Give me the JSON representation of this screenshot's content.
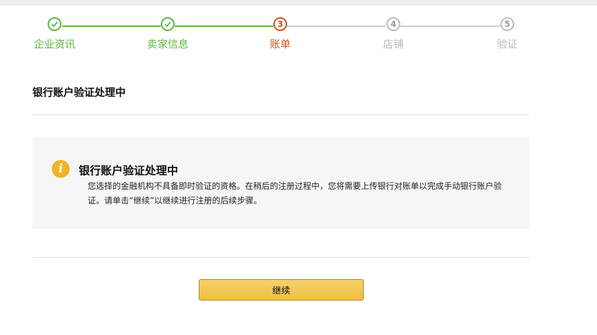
{
  "stepper": {
    "steps": [
      {
        "number": "1",
        "label": "企业资讯",
        "state": "done"
      },
      {
        "number": "2",
        "label": "卖家信息",
        "state": "done"
      },
      {
        "number": "3",
        "label": "账单",
        "state": "current"
      },
      {
        "number": "4",
        "label": "店铺",
        "state": "upcoming"
      },
      {
        "number": "5",
        "label": "验证",
        "state": "upcoming"
      }
    ]
  },
  "page": {
    "section_title": "银行账户验证处理中"
  },
  "notice": {
    "icon": "info-icon",
    "icon_glyph": "i",
    "title": "银行账户验证处理中",
    "body": "您选择的金融机构不具备即时验证的资格。在稍后的注册过程中，您将需要上传银行对账单以完成手动银行账户验证。请单击“继续”以继续进行注册的后续步骤。"
  },
  "actions": {
    "continue_label": "继续"
  },
  "colors": {
    "done": "#58b83c",
    "current": "#c9541a",
    "upcoming": "#bbbbbb",
    "button": "#f0c13c"
  }
}
